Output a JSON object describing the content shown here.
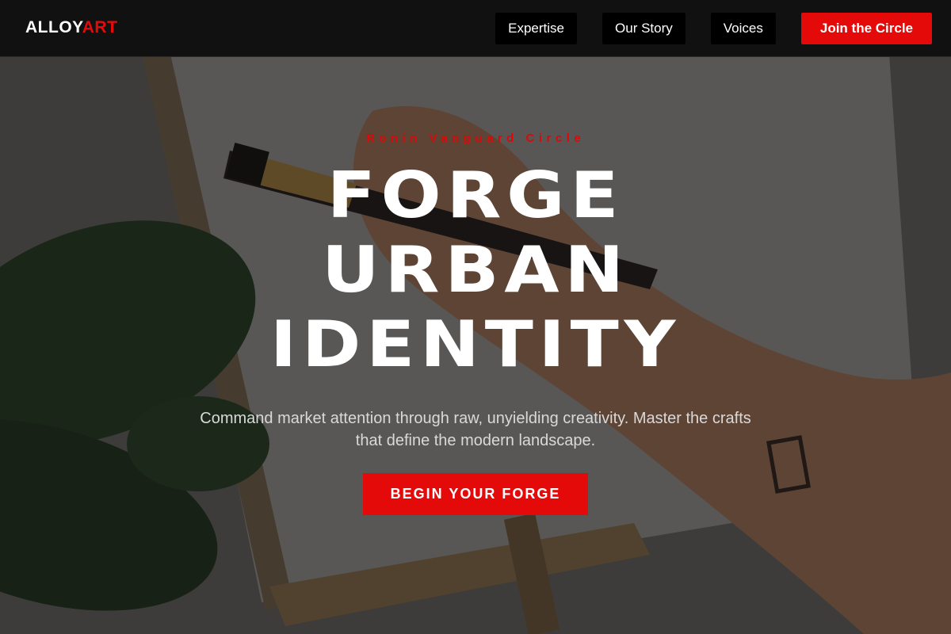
{
  "brand": {
    "logo_primary": "ALLOY",
    "logo_accent": "ART",
    "accent_color": "#e50a0a"
  },
  "nav": {
    "items": [
      {
        "label": "Expertise"
      },
      {
        "label": "Our Story"
      },
      {
        "label": "Voices"
      }
    ],
    "cta_label": "Join the Circle"
  },
  "hero": {
    "eyebrow": "Ronin Vanguard Circle",
    "headline_lines": [
      "FORGE",
      "URBAN",
      "IDENTITY"
    ],
    "subtext": "Command market attention through raw, unyielding creativity. Master the crafts that define the modern landscape.",
    "button_label": "BEGIN YOUR FORGE",
    "background_image": "painting-hand-photo"
  }
}
